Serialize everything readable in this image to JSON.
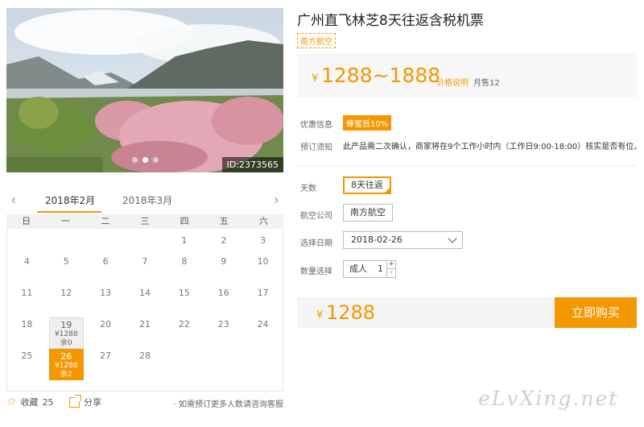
{
  "product": {
    "title": "广州直飞林芝8天往返含税机票",
    "airline_badge": "南方航空",
    "photo_id": "ID:2373565"
  },
  "price": {
    "currency": "¥",
    "range": "1288~1888",
    "info_link": "价格说明",
    "sales": "月售12"
  },
  "info": {
    "promo_label": "优惠信息",
    "promo_tag": "蜂蜜抵10%",
    "notice_label": "预订须知",
    "notice_text": "此产品需二次确认，商家将在9个工作小时内（工作日9:00-18:00）核实是否有位。"
  },
  "options": {
    "days_label": "天数",
    "days_value": "8天往返",
    "airline_label": "航空公司",
    "airline_value": "南方航空",
    "date_label": "选择日期",
    "date_value": "2018-02-26",
    "qty_label": "数量选择",
    "qty_type": "成人",
    "qty_value": "1",
    "plus": "+",
    "minus": "-"
  },
  "total": {
    "currency": "¥",
    "price": "1288",
    "buy_label": "立即购买"
  },
  "calendar": {
    "prev": "‹",
    "next": "›",
    "month_active": "2018年2月",
    "month_next": "2018年3月",
    "weekdays": [
      "日",
      "一",
      "二",
      "三",
      "四",
      "五",
      "六"
    ],
    "days": [
      {
        "d": ""
      },
      {
        "d": ""
      },
      {
        "d": ""
      },
      {
        "d": ""
      },
      {
        "d": "1"
      },
      {
        "d": "2"
      },
      {
        "d": "3"
      },
      {
        "d": "4"
      },
      {
        "d": "5"
      },
      {
        "d": "6"
      },
      {
        "d": "7"
      },
      {
        "d": "8"
      },
      {
        "d": "9"
      },
      {
        "d": "10"
      },
      {
        "d": "11"
      },
      {
        "d": "12"
      },
      {
        "d": "13"
      },
      {
        "d": "14"
      },
      {
        "d": "15"
      },
      {
        "d": "16"
      },
      {
        "d": "17"
      },
      {
        "d": "18"
      },
      {
        "d": "19",
        "price": "¥1288",
        "left": "余0",
        "state": "grey"
      },
      {
        "d": "20"
      },
      {
        "d": "21"
      },
      {
        "d": "22"
      },
      {
        "d": "23"
      },
      {
        "d": "24"
      },
      {
        "d": "25"
      },
      {
        "d": "26",
        "price": "¥1288",
        "left": "余2",
        "state": "active"
      },
      {
        "d": "27"
      },
      {
        "d": "28"
      },
      {
        "d": ""
      },
      {
        "d": ""
      },
      {
        "d": ""
      }
    ]
  },
  "footer": {
    "fav_label": "收藏",
    "fav_count": "25",
    "share_label": "分享",
    "note": "· 如需预订更多人数请咨询客服"
  },
  "watermark": "eLvXing.net",
  "colors": {
    "accent": "#f39800",
    "price_bg": "#f7f7f7"
  }
}
